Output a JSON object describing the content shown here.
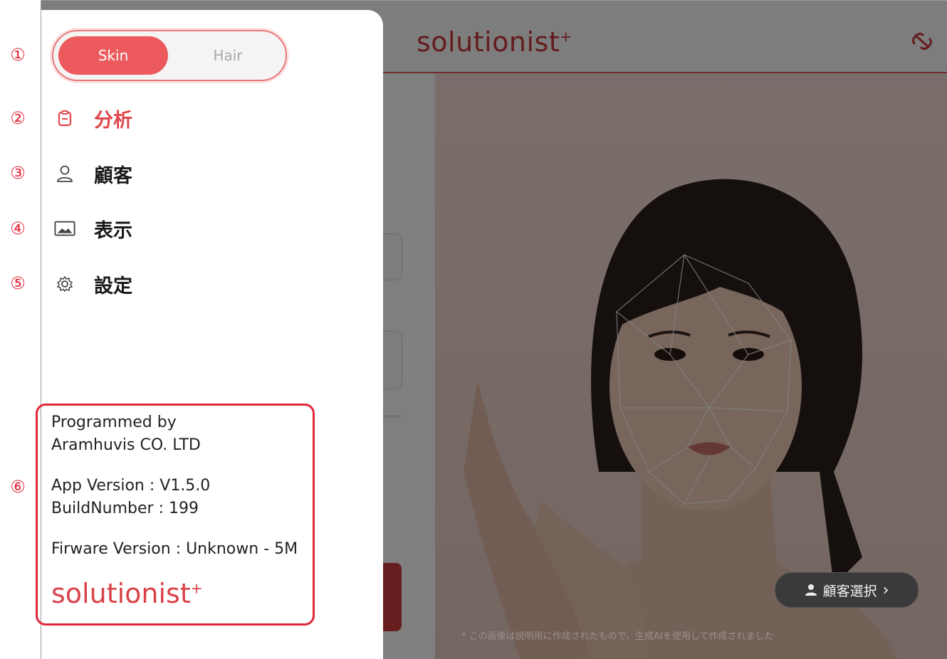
{
  "annotations": [
    "①",
    "②",
    "③",
    "④",
    "⑤",
    "⑥"
  ],
  "app": {
    "logo": "solutionist",
    "logo_mark": "+",
    "customer_select_label": "顧客選択",
    "customer_select_chevron": "›",
    "photo_caption": "* この画像は説明用に作成されたもので、生成AIを使用して作成されました",
    "icons": {
      "unlink": "unlink-icon",
      "person": "person-icon"
    }
  },
  "drawer": {
    "mode_toggle": {
      "options": [
        "Skin",
        "Hair"
      ],
      "selected": "Skin"
    },
    "menu": [
      {
        "label": "分析",
        "icon": "clipboard-icon",
        "active": true
      },
      {
        "label": "顧客",
        "icon": "user-icon",
        "active": false
      },
      {
        "label": "表示",
        "icon": "image-icon",
        "active": false
      },
      {
        "label": "設定",
        "icon": "gear-icon",
        "active": false
      }
    ],
    "info": {
      "programmed_by_label": "Programmed by",
      "company": "Aramhuvis CO. LTD",
      "app_version": "App Version : V1.5.0",
      "build_number": "BuildNumber : 199",
      "firmware_version": "Firware Version : Unknown - 5M",
      "logo": "solutionist",
      "logo_mark": "+"
    }
  },
  "colors": {
    "accent": "#ec5a5d",
    "annotation": "#e0283a"
  }
}
